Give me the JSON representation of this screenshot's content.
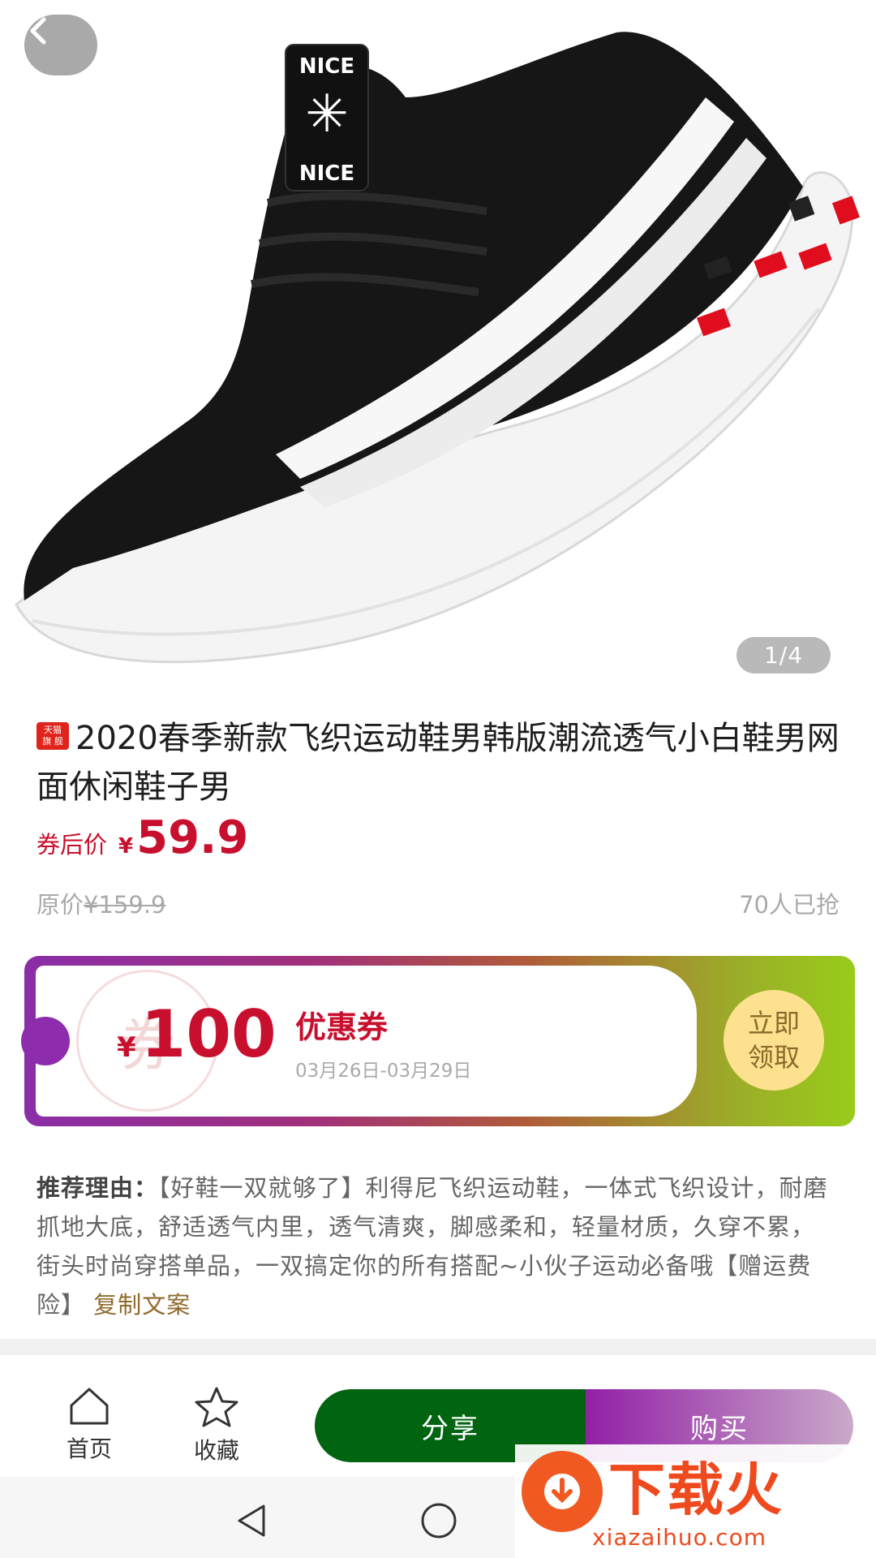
{
  "gallery": {
    "counter": "1/4"
  },
  "product": {
    "badge_line1": "天猫",
    "badge_line2": "旗 舰",
    "title": "2020春季新款飞织运动鞋男韩版潮流透气小白鞋男网面休闲鞋子男",
    "price_label": "券后价",
    "currency": "¥",
    "price": "59.9",
    "original_price_label": "原价",
    "original_price": "¥159.9",
    "sold": "70人已抢"
  },
  "coupon": {
    "stamp": "券",
    "currency": "¥",
    "amount": "100",
    "title": "优惠券",
    "dates": "03月26日-03月29日",
    "claim_line1": "立即",
    "claim_line2": "领取"
  },
  "reason": {
    "label": "推荐理由：",
    "text": "【好鞋一双就够了】利得尼飞织运动鞋，一体式飞织设计，耐磨抓地大底，舒适透气内里，透气清爽，脚感柔和，轻量材质，久穿不累，街头时尚穿搭单品，一双搞定你的所有搭配~小伙子运动必备哦【赠运费险】",
    "copy": "复制文案"
  },
  "bottom_bar": {
    "home": "首页",
    "favorite": "收藏",
    "share": "分享",
    "buy": "购买"
  },
  "shoe_logo": {
    "top": "NICE",
    "bottom": "NICE"
  },
  "watermark": {
    "name": "下载火",
    "url": "xiazaihuo.com"
  },
  "colors": {
    "price_red": "#c8102e",
    "share_green": "#006411",
    "buy_purple": "#9220a6",
    "coupon_gradient_start": "#8a2ea8",
    "coupon_gradient_end": "#98cc1a"
  }
}
